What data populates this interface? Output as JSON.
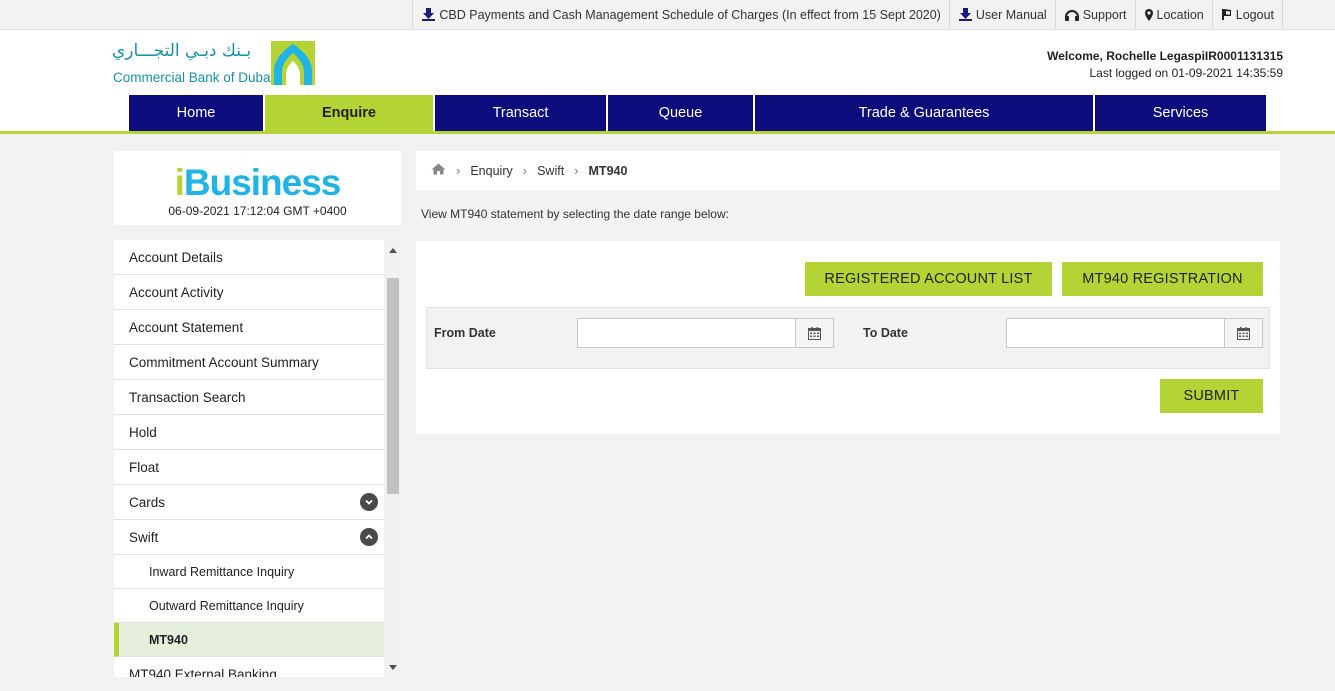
{
  "topbar": {
    "links": [
      {
        "label": "CBD Payments and Cash Management Schedule of Charges (In effect from 15 Sept 2020)",
        "icon": "download-icon"
      },
      {
        "label": "User Manual",
        "icon": "download-icon"
      },
      {
        "label": "Support",
        "icon": "headset-icon"
      },
      {
        "label": "Location",
        "icon": "map-pin-icon"
      },
      {
        "label": "Logout",
        "icon": "logout-icon"
      }
    ]
  },
  "header": {
    "logo_arabic": "بـنك دبـي التجـــاري",
    "logo_english": "Commercial Bank of Dubai",
    "welcome": "Welcome, Rochelle LegaspiIR0001131315",
    "last_logged": "Last logged on 01-09-2021 14:35:59"
  },
  "nav": {
    "items": [
      {
        "label": "Home",
        "active": false
      },
      {
        "label": "Enquire",
        "active": true
      },
      {
        "label": "Transact",
        "active": false
      },
      {
        "label": "Queue",
        "active": false
      },
      {
        "label": "Trade & Guarantees",
        "active": false
      },
      {
        "label": "Services",
        "active": false
      }
    ]
  },
  "brand": {
    "name_i": "i",
    "name_rest": "Business",
    "datetime": "06-09-2021 17:12:04 GMT +0400"
  },
  "sidebar": {
    "items": [
      {
        "label": "Account Details"
      },
      {
        "label": "Account Activity"
      },
      {
        "label": "Account Statement"
      },
      {
        "label": "Commitment Account Summary"
      },
      {
        "label": "Transaction Search"
      },
      {
        "label": "Hold"
      },
      {
        "label": "Float"
      },
      {
        "label": "Cards",
        "expandable": "collapsed"
      },
      {
        "label": "Swift",
        "expandable": "expanded"
      },
      {
        "label": "Inward Remittance Inquiry",
        "sub": true
      },
      {
        "label": "Outward Remittance Inquiry",
        "sub": true
      },
      {
        "label": "MT940",
        "sub": true,
        "active": true
      },
      {
        "label": "MT940 External Banking"
      }
    ]
  },
  "breadcrumb": {
    "items": [
      "Enquiry",
      "Swift",
      "MT940"
    ]
  },
  "content": {
    "intro": "View MT940 statement by selecting the date range below:",
    "registered_button": "REGISTERED ACCOUNT LIST",
    "registration_button": "MT940 REGISTRATION",
    "from_label": "From Date",
    "from_value": "",
    "to_label": "To Date",
    "to_value": "",
    "submit_button": "SUBMIT"
  },
  "colors": {
    "accent_green": "#b4d334",
    "nav_blue": "#0c0c7c",
    "brand_cyan": "#1fb3e6"
  }
}
